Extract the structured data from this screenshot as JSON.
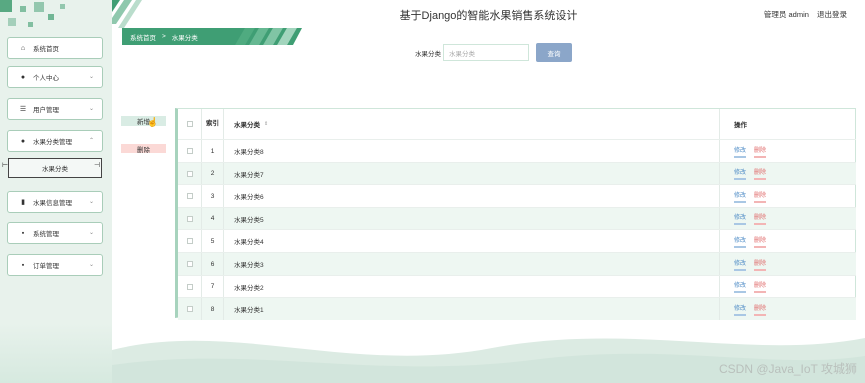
{
  "app": {
    "title": "基于Django的智能水果销售系统设计",
    "user_label": "管理员 admin",
    "logout_label": "退出登录"
  },
  "sidebar": {
    "items": [
      {
        "label": "系统首页",
        "icon": "home-icon",
        "glyph": "⌂"
      },
      {
        "label": "个人中心",
        "icon": "person-icon",
        "glyph": "●"
      },
      {
        "label": "用户管理",
        "icon": "sliders-icon",
        "glyph": "☰"
      },
      {
        "label": "水果分类管理",
        "icon": "person-icon",
        "glyph": "●"
      },
      {
        "label": "水果信息管理",
        "icon": "bar-chart-icon",
        "glyph": "▮"
      },
      {
        "label": "系统管理",
        "icon": "grid-icon",
        "glyph": "▪"
      },
      {
        "label": "订单管理",
        "icon": "grid-icon",
        "glyph": "▪"
      }
    ],
    "sub_item": "水果分类"
  },
  "breadcrumb": {
    "home": "系统首页",
    "separator": ">",
    "current": "水果分类"
  },
  "search": {
    "label": "水果分类",
    "placeholder": "水果分类",
    "button": "查询"
  },
  "actions": {
    "add": "新增",
    "delete": "删除"
  },
  "table": {
    "headers": {
      "index": "索引",
      "name": "水果分类",
      "ops": "操作"
    },
    "edit_label": "修改",
    "delete_label": "删除",
    "rows": [
      {
        "no": "1",
        "name": "水果分类8"
      },
      {
        "no": "2",
        "name": "水果分类7"
      },
      {
        "no": "3",
        "name": "水果分类6"
      },
      {
        "no": "4",
        "name": "水果分类5"
      },
      {
        "no": "5",
        "name": "水果分类4"
      },
      {
        "no": "6",
        "name": "水果分类3"
      },
      {
        "no": "7",
        "name": "水果分类2"
      },
      {
        "no": "8",
        "name": "水果分类1"
      }
    ]
  },
  "watermark": "CSDN @Java_IoT 攻城狮",
  "colors": {
    "accent": "#3f9e74",
    "search_button": "#8ba6c9",
    "edit": "#4f8cc6",
    "delete": "#e06a6a"
  }
}
